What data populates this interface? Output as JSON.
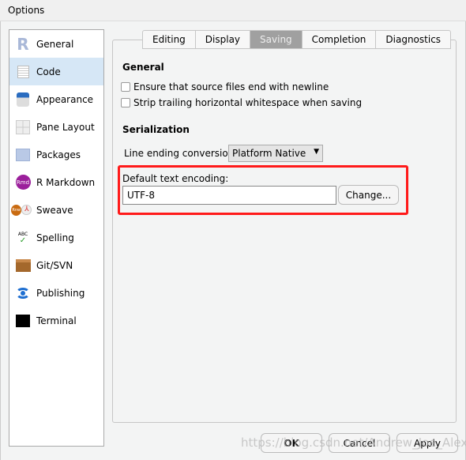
{
  "window": {
    "title": "Options"
  },
  "sidebar": {
    "items": [
      {
        "label": "General",
        "icon": "r-logo-icon"
      },
      {
        "label": "Code",
        "icon": "code-document-icon",
        "selected": true
      },
      {
        "label": "Appearance",
        "icon": "paint-bucket-icon"
      },
      {
        "label": "Pane Layout",
        "icon": "pane-grid-icon"
      },
      {
        "label": "Packages",
        "icon": "package-box-icon"
      },
      {
        "label": "R Markdown",
        "icon": "rmd-icon",
        "icon_text": "Rmd"
      },
      {
        "label": "Sweave",
        "icon": "sweave-pdf-icon",
        "icon_text": "Rnw"
      },
      {
        "label": "Spelling",
        "icon": "spellcheck-icon",
        "icon_text": "ABC"
      },
      {
        "label": "Git/SVN",
        "icon": "git-box-icon"
      },
      {
        "label": "Publishing",
        "icon": "publishing-icon"
      },
      {
        "label": "Terminal",
        "icon": "terminal-icon"
      }
    ]
  },
  "tabs": [
    {
      "label": "Editing"
    },
    {
      "label": "Display"
    },
    {
      "label": "Saving",
      "active": true
    },
    {
      "label": "Completion"
    },
    {
      "label": "Diagnostics"
    }
  ],
  "general": {
    "heading": "General",
    "opt1": {
      "label": "Ensure that source files end with newline",
      "checked": false
    },
    "opt2": {
      "label": "Strip trailing horizontal whitespace when saving",
      "checked": false
    }
  },
  "serialization": {
    "heading": "Serialization",
    "line_ending_label": "Line ending conversion:",
    "line_ending_value": "Platform Native",
    "encoding_label": "Default text encoding:",
    "encoding_value": "UTF-8",
    "change_label": "Change..."
  },
  "footer": {
    "ok": "OK",
    "cancel": "Cancel",
    "apply": "Apply"
  },
  "watermark": "https://blog.csdn.net/Andrew_Joe_Alex",
  "colors": {
    "highlight": "#ff1a1a",
    "selected": "#d6e7f6"
  }
}
